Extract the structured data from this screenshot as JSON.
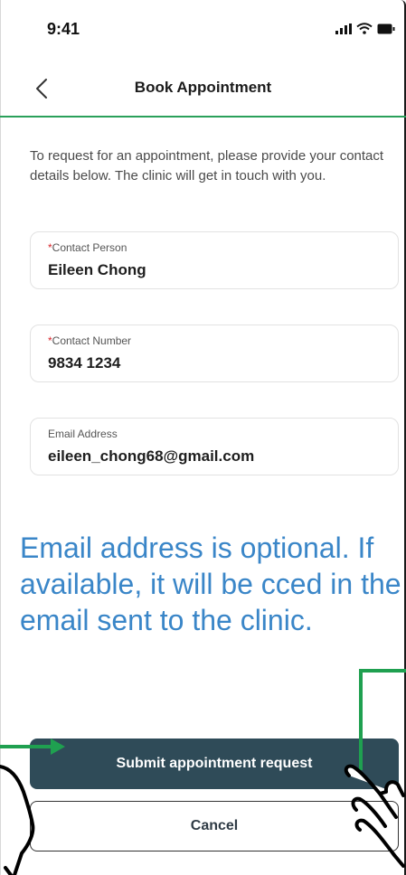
{
  "status_bar": {
    "time": "9:41",
    "icons": [
      "signal-icon",
      "wifi-icon",
      "battery-icon"
    ]
  },
  "nav": {
    "back_icon": "chevron-left-icon",
    "title": "Book Appointment"
  },
  "intro": "To request for an appointment, please provide your contact details below. The clinic will get in touch with you.",
  "form": {
    "contact_person": {
      "required_mark": "*",
      "label": "Contact Person",
      "value": "Eileen Chong"
    },
    "contact_number": {
      "required_mark": "*",
      "label": "Contact Number",
      "value": "9834 1234"
    },
    "email": {
      "label": "Email Address",
      "value": "eileen_chong68@gmail.com"
    }
  },
  "annotation": {
    "callout": "Email address is optional. If available, it will be cced in the email sent to the clinic.",
    "callout_color": "#3a86c8",
    "arrow_color": "#1fa050"
  },
  "actions": {
    "submit_label": "Submit appointment request",
    "cancel_label": "Cancel"
  },
  "colors": {
    "accent_green": "#2aa05a",
    "primary_button": "#2f4b58",
    "required_star": "#d8262c"
  }
}
